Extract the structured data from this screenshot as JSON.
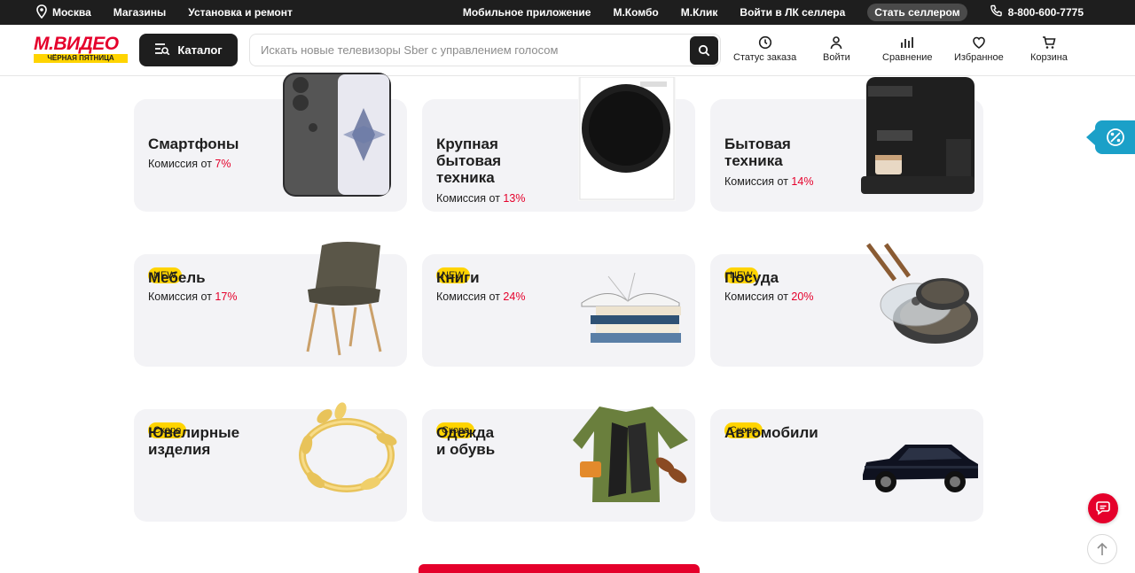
{
  "topbar": {
    "city": "Москва",
    "stores": "Магазины",
    "install": "Установка и ремонт",
    "app": "Мобильное приложение",
    "mcombo": "М.Комбо",
    "mclick": "М.Клик",
    "seller_login": "Войти в ЛК селлера",
    "become_seller": "Стать селлером",
    "phone": "8-800-600-7775"
  },
  "header": {
    "logo_text": "М.ВИДЕО",
    "logo_sub": "ЧЁРНАЯ ПЯТНИЦА",
    "catalog_label": "Каталог",
    "search_placeholder": "Искать новые телевизоры Sber с управлением голосом",
    "nav": {
      "order_status": "Статус заказа",
      "login": "Войти",
      "compare": "Сравнение",
      "favorites": "Избранное",
      "cart": "Корзина"
    }
  },
  "colors": {
    "accent": "#e5002b",
    "badge": "#ffd400",
    "dark": "#1e1e1e",
    "card_bg": "#f3f3f6",
    "side_tab": "#1ba0c8"
  },
  "categories": [
    {
      "title": "Смартфоны",
      "commission_label": "Комиссия от",
      "commission_value": "7%",
      "badge": ""
    },
    {
      "title": "Крупная\nбытовая\nтехника",
      "commission_label": "Комиссия от",
      "commission_value": "13%",
      "badge": ""
    },
    {
      "title": "Бытовая\nтехника",
      "commission_label": "Комиссия от",
      "commission_value": "14%",
      "badge": ""
    },
    {
      "title": "Мебель",
      "commission_label": "Комиссия от",
      "commission_value": "17%",
      "badge": "NEW"
    },
    {
      "title": "Книги",
      "commission_label": "Комиссия от",
      "commission_value": "24%",
      "badge": "NEW"
    },
    {
      "title": "Посуда",
      "commission_label": "Комиссия от",
      "commission_value": "20%",
      "badge": "NEW"
    },
    {
      "title": "Ювелирные\nизделия",
      "badge": "Скоро"
    },
    {
      "title": "Одежда\nи обувь",
      "badge": "Скоро"
    },
    {
      "title": "Автомобили",
      "badge": "Скоро"
    }
  ]
}
